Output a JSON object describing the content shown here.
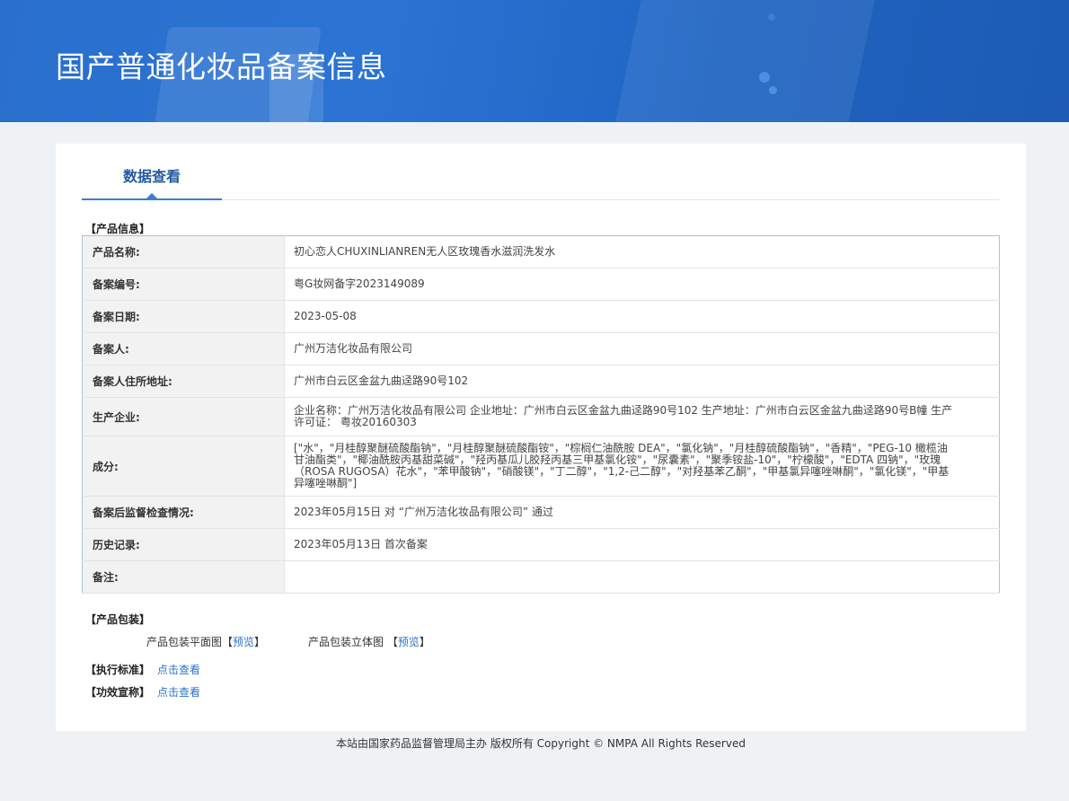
{
  "header": {
    "title": "国产普通化妆品备案信息"
  },
  "tabs": [
    {
      "label": "数据查看"
    }
  ],
  "product_info": {
    "section_title": "【产品信息】",
    "rows": [
      {
        "label": "产品名称:",
        "value": "初心恋人CHUXINLIANREN无人区玫瑰香水滋润洗发水"
      },
      {
        "label": "备案编号:",
        "value": "粤G妆网备字2023149089"
      },
      {
        "label": "备案日期:",
        "value": "2023-05-08"
      },
      {
        "label": "备案人:",
        "value": "广州万洁化妆品有限公司"
      },
      {
        "label": "备案人住所地址:",
        "value": "广州市白云区金盆九曲迳路90号102"
      },
      {
        "label": "生产企业:",
        "value": "企业名称：广州万洁化妆品有限公司 企业地址：广州市白云区金盆九曲迳路90号102 生产地址：广州市白云区金盆九曲迳路90号B幢 生产许可证：  粤妆20160303"
      },
      {
        "label": "成分:",
        "value": "[\"水\"，\"月桂醇聚醚硫酸酯钠\"，\"月桂醇聚醚硫酸酯铵\"，\"棕榈仁油酰胺 DEA\"，\"氯化钠\"，\"月桂醇硫酸酯钠\"，\"香精\"，\"PEG-10 橄榄油甘油酯类\"，\"椰油酰胺丙基甜菜碱\"，\"羟丙基瓜儿胶羟丙基三甲基氯化铵\"，\"尿囊素\"，\"聚季铵盐-10\"，\"柠檬酸\"，\"EDTA 四钠\"，\"玫瑰（ROSA RUGOSA）花水\"，\"苯甲酸钠\"，\"硝酸镁\"，\"丁二醇\"，\"1,2-己二醇\"，\"对羟基苯乙酮\"，\"甲基氯异噻唑啉酮\"，\"氯化镁\"，\"甲基异噻唑啉酮\"]"
      },
      {
        "label": "备案后监督检查情况:",
        "value": "2023年05月15日 对 “广州万洁化妆品有限公司” 通过"
      },
      {
        "label": "历史记录:",
        "value": "2023年05月13日 首次备案"
      },
      {
        "label": "备注:",
        "value": ""
      }
    ]
  },
  "packaging": {
    "section_title": "【产品包装】",
    "items": [
      {
        "label": "产品包装平面图",
        "open": "【",
        "link": "预览",
        "close": "】"
      },
      {
        "label": "产品包装立体图",
        "open": "【",
        "link": "预览",
        "close": "】"
      }
    ]
  },
  "standards": {
    "title": "【执行标准】",
    "link": "点击查看"
  },
  "efficacy": {
    "title": "【功效宣称】",
    "link": "点击查看"
  },
  "footer": {
    "text": "本站由国家药品监督管理局主办 版权所有 Copyright © NMPA All Rights Reserved"
  }
}
